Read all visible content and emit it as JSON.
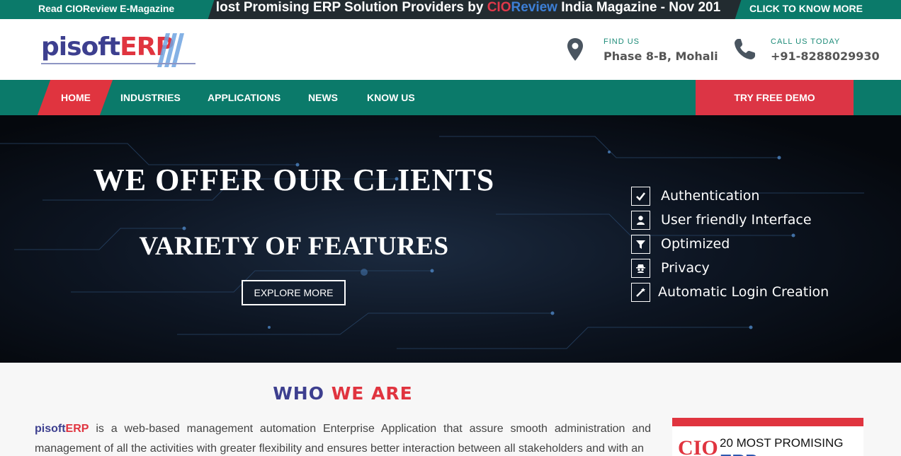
{
  "topbar": {
    "emag_link": "Read CIOReview E-Magazine",
    "ticker": {
      "before": "lost Promising ERP Solution Providers by ",
      "cio": "CIO",
      "review": "Review",
      "after": " India Magazine - Nov 201"
    },
    "know_more": "CLICK TO KNOW MORE"
  },
  "header": {
    "logo": {
      "part1": "pisoft",
      "part2": "ERP"
    },
    "find_us": {
      "label": "FIND US",
      "value": "Phase 8-B, Mohali"
    },
    "call_us": {
      "label": "CALL US TODAY",
      "value": "+91-8288029930"
    }
  },
  "nav": {
    "items": [
      {
        "label": "HOME"
      },
      {
        "label": "INDUSTRIES"
      },
      {
        "label": "APPLICATIONS"
      },
      {
        "label": "NEWS"
      },
      {
        "label": "KNOW US"
      }
    ],
    "active": "HOME",
    "cta": "TRY FREE DEMO"
  },
  "hero": {
    "title_line1": "WE OFFER OUR CLIENTS",
    "title_line2": "VARIETY OF FEATURES",
    "button": "EXPLORE MORE",
    "features": [
      {
        "icon": "check-icon",
        "label": "Authentication"
      },
      {
        "icon": "user-icon",
        "label": "User friendly Interface"
      },
      {
        "icon": "filter-icon",
        "label": "Optimized"
      },
      {
        "icon": "spy-icon",
        "label": "Privacy"
      },
      {
        "icon": "magic-wand-icon",
        "label": "Automatic Login Creation"
      }
    ]
  },
  "about": {
    "title_part1": "WHO",
    "title_part2": "WE ARE",
    "brand1": "pisoft",
    "brand2": "ERP",
    "text": " is a web-based management automation Enterprise Application that assure smooth administration and management of all the activities with greater flexibility and ensures better interaction between all stakeholders and with an",
    "award": {
      "cio": "CIO",
      "line1": "20 MOST PROMISING",
      "line2": "ERP"
    }
  },
  "colors": {
    "teal": "#0b7a6a",
    "red": "#e0343f",
    "navy": "#3d3f8f",
    "dark": "#222b30"
  }
}
